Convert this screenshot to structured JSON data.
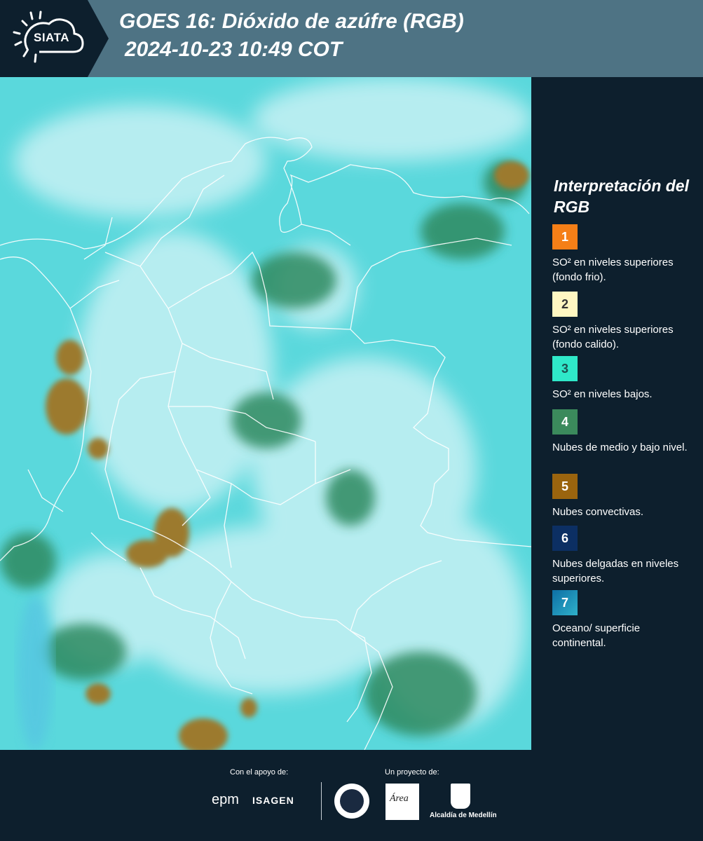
{
  "header": {
    "logo": "SIATA",
    "title_line1": "GOES 16: Dióxido de azúfre (RGB)",
    "title_line2": "2024-10-23 10:49 COT"
  },
  "legend": {
    "title": "Interpretación del RGB",
    "items": [
      {
        "num": "1",
        "color": "#f57f17",
        "num_color": "#ffffff",
        "text": "SO² en niveles superiores (fondo frio)."
      },
      {
        "num": "2",
        "color": "#fff7c2",
        "num_color": "#333333",
        "text": "SO² en niveles superiores (fondo calido)."
      },
      {
        "num": "3",
        "color": "#2fe8c9",
        "num_color": "#1d5050",
        "text": "SO² en niveles bajos."
      },
      {
        "num": "4",
        "color": "#3b8a5c",
        "num_color": "#ffffff",
        "text": "Nubes de medio y bajo nivel."
      },
      {
        "num": "5",
        "color": "#9a640e",
        "num_color": "#ffffff",
        "text": "Nubes convectivas."
      },
      {
        "num": "6",
        "color": "#0c2f63",
        "num_color": "#ffffff",
        "text": "Nubes delgadas en niveles superiores."
      },
      {
        "num": "7",
        "color": "#1d8fb8",
        "num_color": "#ffffff",
        "text": "Oceano/ superficie continental."
      }
    ]
  },
  "footer": {
    "support_label": "Con el apoyo de:",
    "project_label": "Un proyecto de:",
    "epm": "epm",
    "isagen": "ISAGEN",
    "area": "Área",
    "alcaldia": "Alcaldía de Medellín"
  },
  "colors": {
    "header_bg": "#4e7384",
    "panel_bg": "#0d1f2d",
    "map_base": "#5ee4e4",
    "map_cloud": "#c9f2f4",
    "map_green": "#3f8e52",
    "map_brown": "#9b7a2c"
  }
}
